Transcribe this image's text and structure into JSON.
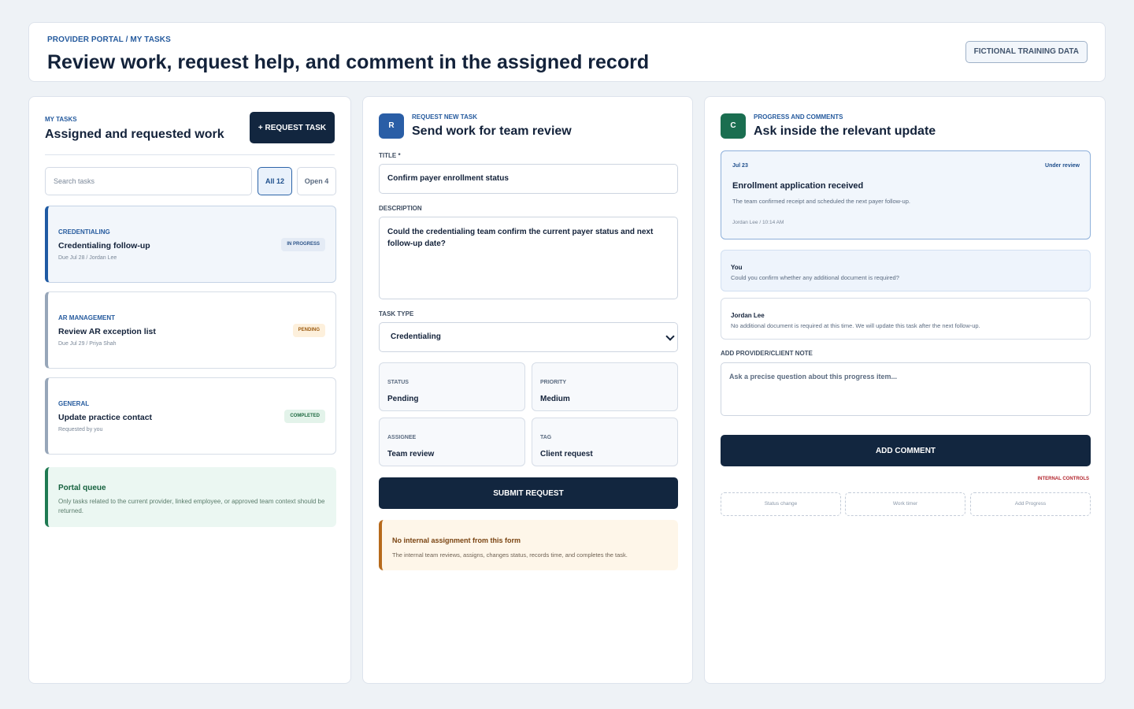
{
  "header": {
    "breadcrumb": "PROVIDER PORTAL / MY TASKS",
    "title": "Review work, request help, and comment in the assigned record",
    "badge": "FICTIONAL TRAINING DATA"
  },
  "tasks_panel": {
    "eyebrow": "MY TASKS",
    "title": "Assigned and requested work",
    "request_button": "+ REQUEST TASK",
    "search_placeholder": "Search tasks",
    "filters": [
      {
        "label": "All 12",
        "active": true
      },
      {
        "label": "Open 4",
        "active": false
      }
    ],
    "tasks": [
      {
        "category": "CREDENTIALING",
        "title": "Credentialing follow-up",
        "meta": "Due Jul 28 / Jordan Lee",
        "status": "IN PROGRESS",
        "active": true
      },
      {
        "category": "AR MANAGEMENT",
        "title": "Review AR exception list",
        "meta": "Due Jul 29 / Priya Shah",
        "status": "PENDING",
        "active": false
      },
      {
        "category": "GENERAL",
        "title": "Update practice contact",
        "meta": "Requested by you",
        "status": "COMPLETED",
        "active": false
      }
    ],
    "queue": {
      "title": "Portal queue",
      "description": "Only tasks related to the current provider, linked employee, or approved team context should be returned."
    }
  },
  "request_panel": {
    "avatar": "R",
    "eyebrow": "REQUEST NEW TASK",
    "title": "Send work for team review",
    "title_label": "TITLE *",
    "title_value": "Confirm payer enrollment status",
    "description_label": "DESCRIPTION",
    "description_value": "Could the credentialing team confirm the current payer status and next follow-up date?",
    "task_type_label": "TASK TYPE",
    "task_type_value": "Credentialing",
    "fields": [
      {
        "label": "STATUS",
        "value": "Pending"
      },
      {
        "label": "PRIORITY",
        "value": "Medium"
      },
      {
        "label": "ASSIGNEE",
        "value": "Team review"
      },
      {
        "label": "TAG",
        "value": "Client request"
      }
    ],
    "submit": "SUBMIT REQUEST",
    "notice": {
      "title": "No internal assignment from this form",
      "description": "The internal team reviews, assigns, changes status, records time, and completes the task."
    }
  },
  "comments_panel": {
    "avatar": "C",
    "eyebrow": "PROGRESS AND COMMENTS",
    "title": "Ask inside the relevant update",
    "update": {
      "date": "Jul 23",
      "status": "Under review",
      "title": "Enrollment application received",
      "description": "The team confirmed receipt and scheduled the next payer follow-up.",
      "meta": "Jordan Lee / 10:14 AM"
    },
    "comments": [
      {
        "author": "You",
        "text": "Could you confirm whether any additional document is required?"
      },
      {
        "author": "Jordan Lee",
        "text": "No additional document is required at this time. We will update this task after the next follow-up."
      }
    ],
    "note_label": "ADD PROVIDER/CLIENT NOTE",
    "note_placeholder": "Ask a precise question about this progress item...",
    "add_button": "ADD COMMENT",
    "internal_label": "INTERNAL CONTROLS",
    "internal_controls": [
      "Status change",
      "Work timer",
      "Add Progress"
    ]
  }
}
